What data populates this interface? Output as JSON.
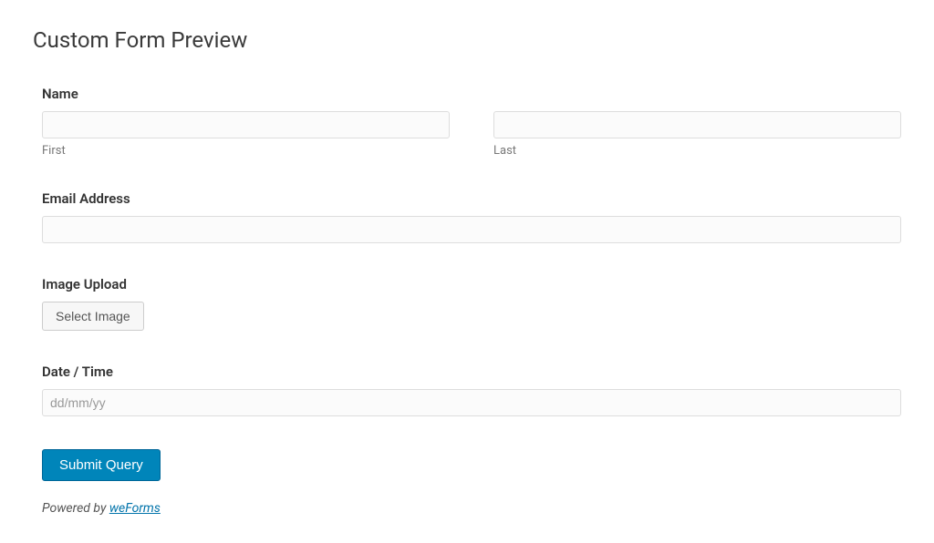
{
  "page": {
    "title": "Custom Form Preview"
  },
  "form": {
    "name": {
      "label": "Name",
      "first_sublabel": "First",
      "last_sublabel": "Last",
      "first_value": "",
      "last_value": ""
    },
    "email": {
      "label": "Email Address",
      "value": ""
    },
    "image_upload": {
      "label": "Image Upload",
      "button_label": "Select Image"
    },
    "datetime": {
      "label": "Date / Time",
      "placeholder": "dd/mm/yy",
      "value": ""
    },
    "submit": {
      "label": "Submit Query"
    }
  },
  "footer": {
    "powered_by_prefix": "Powered by ",
    "powered_by_link": "weForms"
  }
}
